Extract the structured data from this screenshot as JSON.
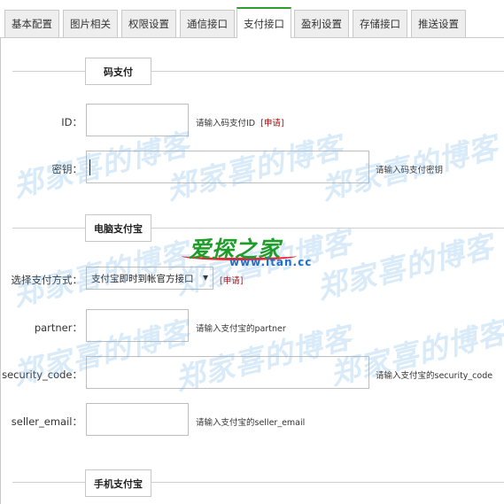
{
  "tabs": [
    {
      "label": "基本配置"
    },
    {
      "label": "图片相关"
    },
    {
      "label": "权限设置"
    },
    {
      "label": "通信接口"
    },
    {
      "label": "支付接口",
      "active": true
    },
    {
      "label": "盈利设置"
    },
    {
      "label": "存储接口"
    },
    {
      "label": "推送设置"
    }
  ],
  "sections": {
    "code_pay": "码支付",
    "pc_alipay": "电脑支付宝",
    "mobile_alipay": "手机支付宝"
  },
  "form": {
    "id": {
      "label": "ID：",
      "value": "",
      "hint": "请输入码支付ID",
      "apply": "[申请]"
    },
    "secret": {
      "label": "密钥：",
      "value": "",
      "hint": "请输入码支付密钥"
    },
    "pay_method": {
      "label": "选择支付方式：",
      "selected": "支付宝即时到帐官方接口",
      "apply": "[申请]"
    },
    "partner": {
      "label": "partner：",
      "value": "",
      "hint": "请输入支付宝的partner"
    },
    "security_code": {
      "label": "security_code：",
      "value": "",
      "hint": "请输入支付宝的security_code"
    },
    "seller_email": {
      "label": "seller_email：",
      "value": "",
      "hint": "请输入支付宝的seller_email"
    }
  },
  "watermark": {
    "text": "郑家喜的博客"
  },
  "logo": {
    "top": "爱探之家",
    "bottom": "www.itan.cc"
  },
  "colors": {
    "active_tab_accent": "#2e9d2e",
    "apply_link": "#c00000",
    "watermark": "#78b4e6",
    "logo_green": "#1f9c2a",
    "logo_blue": "#1f6fd1"
  }
}
